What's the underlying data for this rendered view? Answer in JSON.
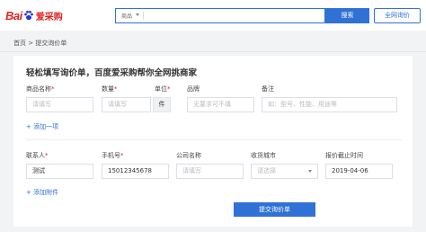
{
  "header": {
    "logo_text": "Bai",
    "logo_sub": "爱采购",
    "search_category": "商品",
    "search_button": "搜索",
    "quote_button": "全网询价"
  },
  "breadcrumb": "首页 > 提交询价单",
  "form": {
    "title": "轻松填写询价单，百度爱采购帮你全网挑商家",
    "product": {
      "name_label": "商品名称",
      "qty_label": "数量",
      "unit_label": "单位",
      "brand_label": "品牌",
      "note_label": "备注",
      "name_placeholder": "请填写",
      "qty_placeholder": "请填写",
      "unit_value": "件",
      "brand_placeholder": "无要求可不填",
      "note_placeholder": "如：型号、性能、用途等"
    },
    "add_item": "+ 添加一项",
    "contact": {
      "contact_label": "联系人",
      "phone_label": "手机号",
      "company_label": "公司名称",
      "city_label": "收货城市",
      "deadline_label": "报价截止时间",
      "contact_value": "测试",
      "phone_value": "15012345678",
      "company_placeholder": "请填写",
      "city_placeholder": "请选择",
      "deadline_value": "2019-04-06"
    },
    "add_attachment": "+ 添加附件",
    "submit": "提交询价单"
  },
  "colors": {
    "brand_red": "#e52323",
    "primary_blue": "#3071d6"
  }
}
